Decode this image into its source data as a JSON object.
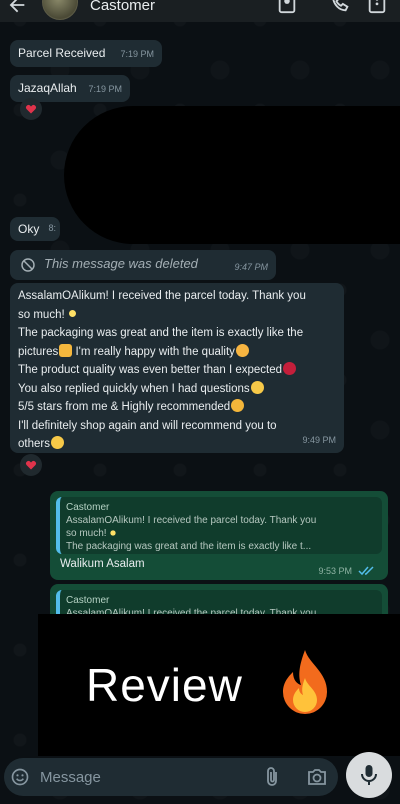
{
  "header": {
    "contact_name": "Castomer",
    "icons": [
      "back-arrow-icon",
      "avatar",
      "contact-card-icon",
      "add-call-icon",
      "more-vert-icon"
    ]
  },
  "messages": [
    {
      "text": "Parcel Received",
      "time": "7:19 PM"
    },
    {
      "text": "JazaqAllah",
      "time": "7:19 PM",
      "reaction": "red-heart"
    },
    {
      "text": "Oky",
      "time": "8:"
    },
    {
      "deleted_text": "This message was deleted",
      "time": "9:47 PM"
    }
  ],
  "review_message": {
    "lines": [
      "AssalamOAlikum! I received the parcel today. Thank you",
      "so much!",
      "The packaging was great and the item is exactly like the",
      "pictures",
      " I'm really happy with the quality",
      "The product quality was even better than I expected",
      "You also replied quickly when I had questions",
      "5/5 stars from me & Highly recommended",
      "I'll definitely shop again and will recommend you to",
      "others"
    ],
    "time": "9:49 PM",
    "reaction": "red-heart",
    "emojis": [
      "sparkles",
      "thumbs-up",
      "smiling-face-with-hearts",
      "red-heart",
      "smiling-face",
      "partying-face",
      "smiling-face"
    ]
  },
  "replies": [
    {
      "quote_name": "Castomer",
      "quote_line1": "AssalamOAlikum! I received the parcel today. Thank you",
      "quote_line2": "so much!",
      "quote_line3": "The packaging was great and the item is exactly like t...",
      "text": "Walikum Asalam",
      "time": "9:53 PM"
    },
    {
      "quote_name": "Castomer",
      "quote_line1": "AssalamOAlikum! I received the parcel today. Thank you"
    }
  ],
  "overlay": {
    "title": "Review",
    "icon": "fire-icon"
  },
  "composer": {
    "placeholder": "Message"
  },
  "colors": {
    "incoming_bubble": "#1f2c33",
    "outgoing_bubble": "#144d37",
    "read_ticks": "#53bdeb",
    "background": "#0b1014"
  }
}
